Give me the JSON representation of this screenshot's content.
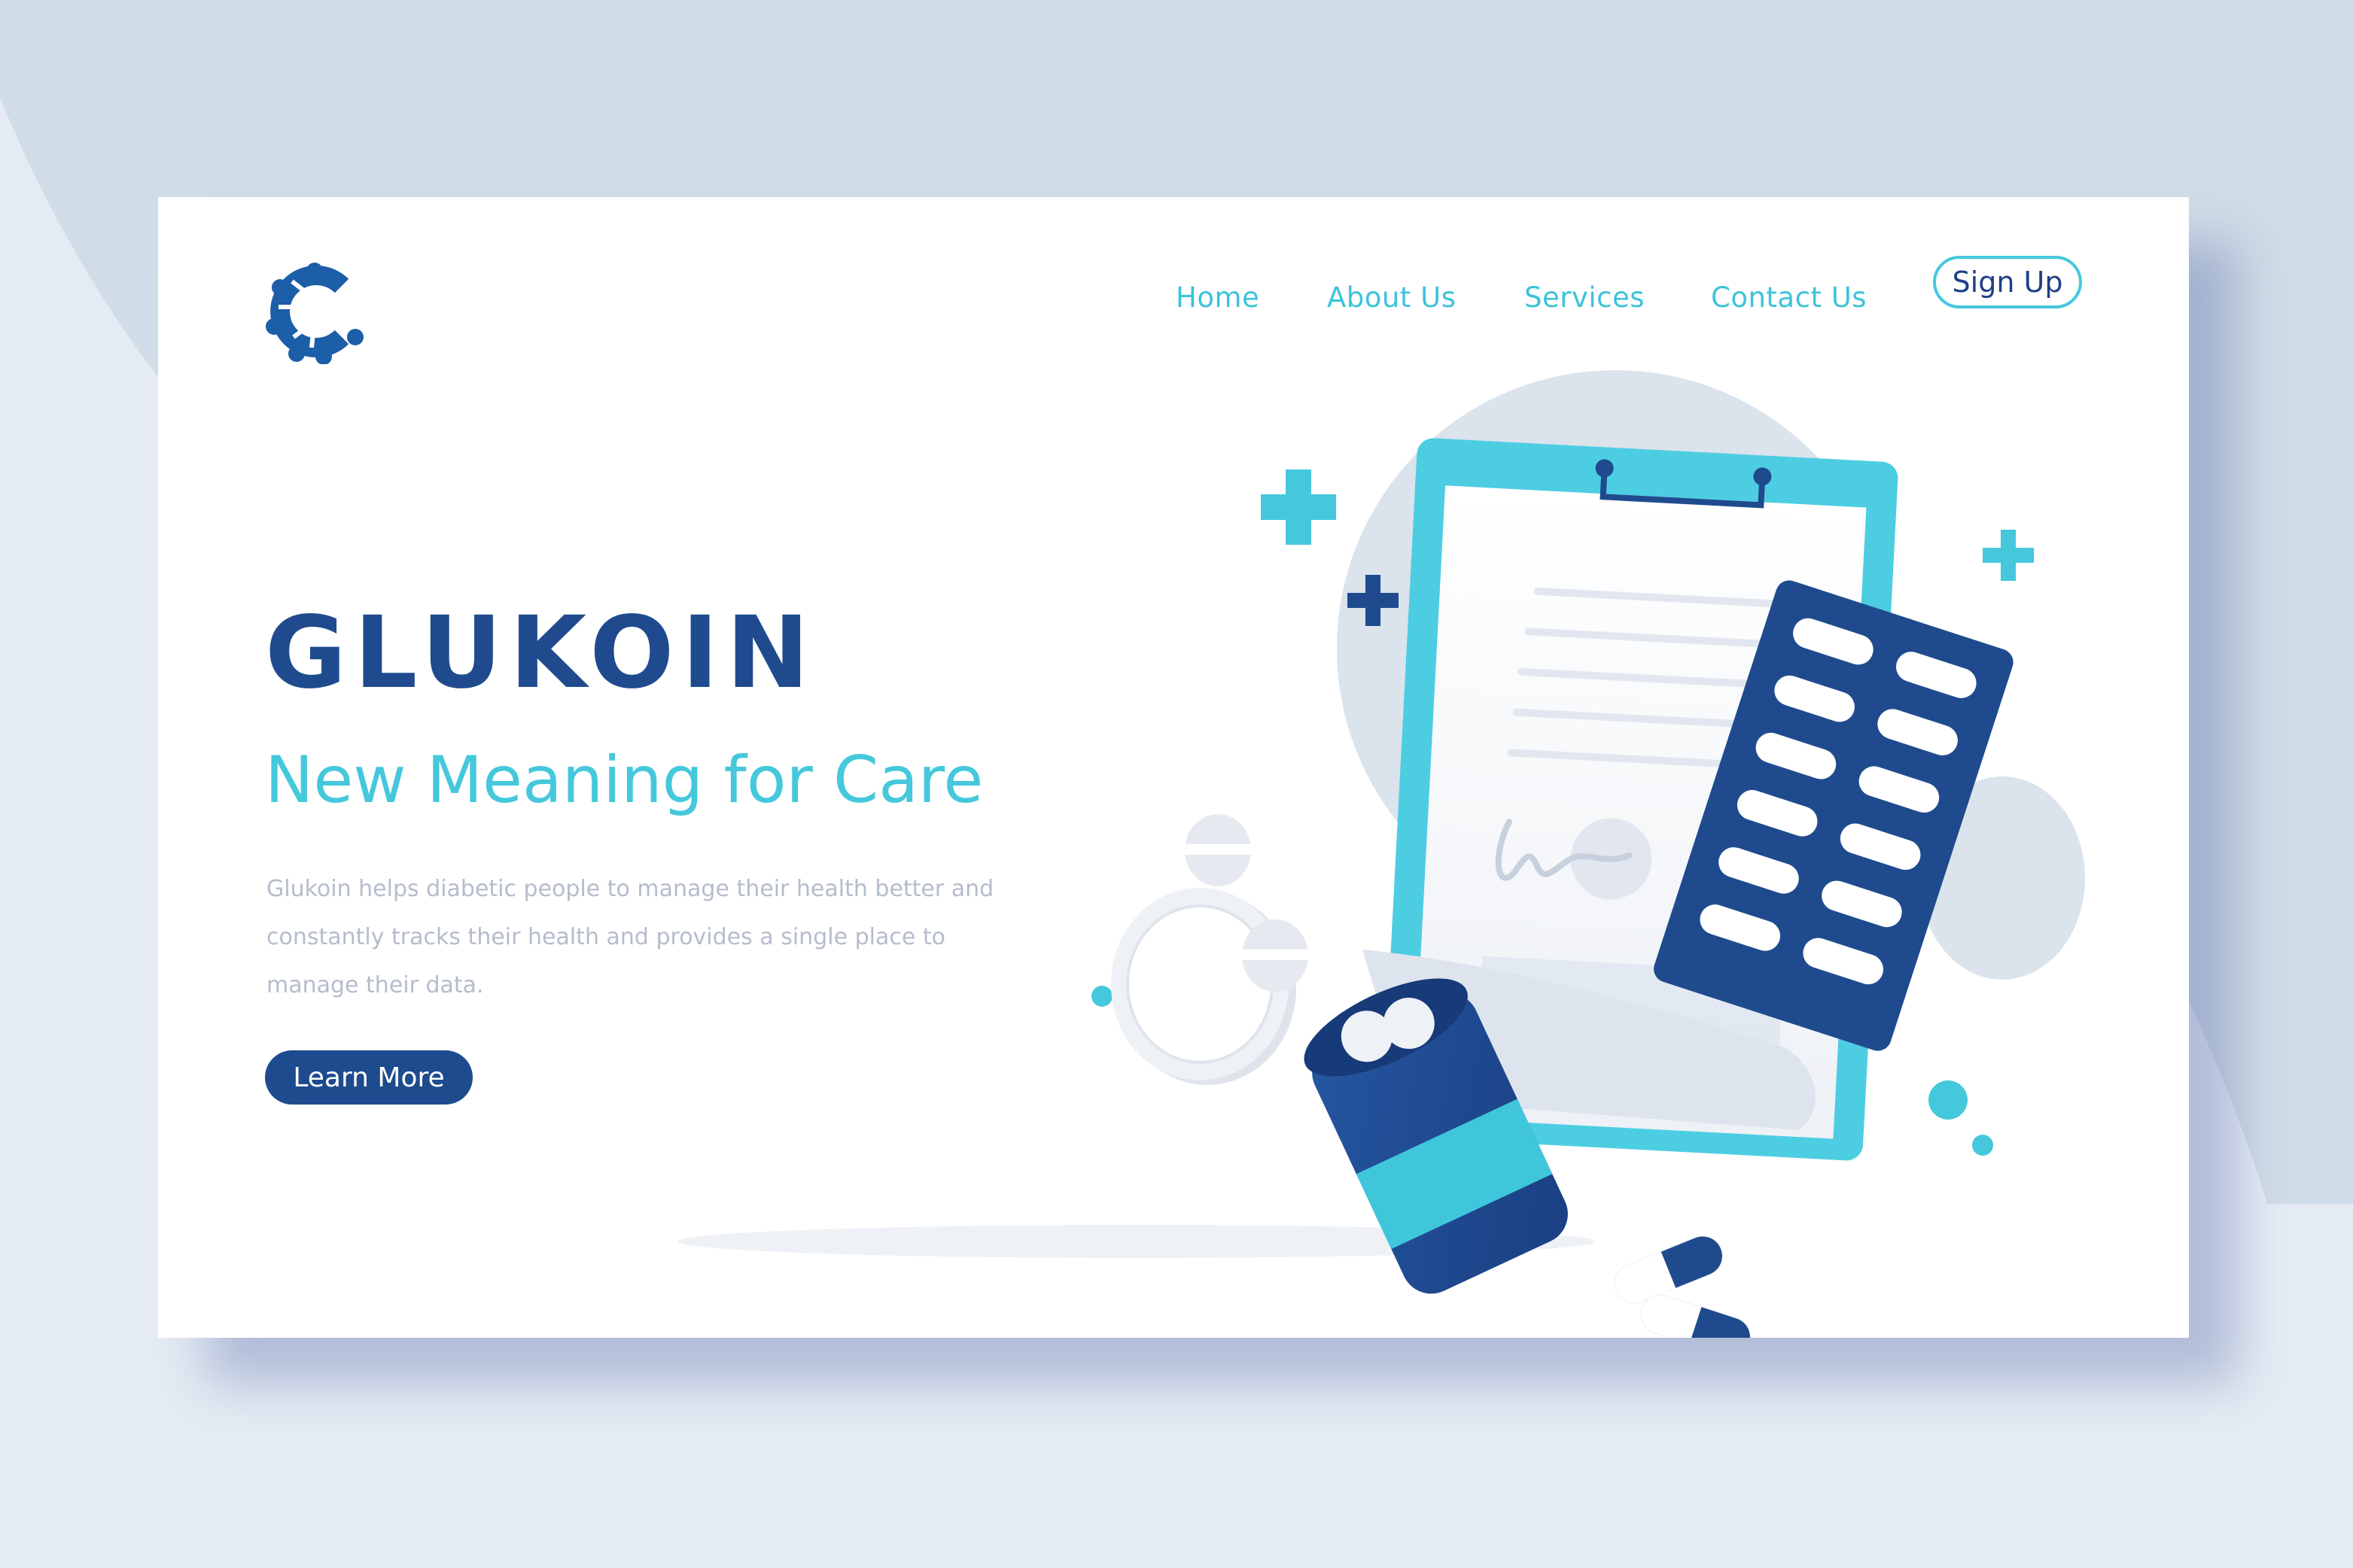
{
  "colors": {
    "page_background": "#d0dce7",
    "card_background": "#ffffff",
    "brand_dark_blue": "#1f4b8e",
    "accent_cyan": "#45c8dc",
    "muted_text": "#b5bdcc"
  },
  "header": {
    "logo": "glukoin-logo-icon",
    "nav": {
      "home": "Home",
      "about": "About Us",
      "services": "Services",
      "contact": "Contact Us"
    },
    "signup_label": "Sign Up"
  },
  "hero": {
    "title": "GLUKOIN",
    "subtitle": "New Meaning for Care",
    "description": "Glukoin helps diabetic people to manage their health better and constantly tracks their health and provides a single place to manage their data.",
    "cta_label": "Learn More"
  },
  "illustration": {
    "icons": [
      "clipboard-icon",
      "pill-blister-pack-icon",
      "pill-bottle-icon",
      "capsule-icon",
      "tablet-icon",
      "plus-icon"
    ]
  }
}
